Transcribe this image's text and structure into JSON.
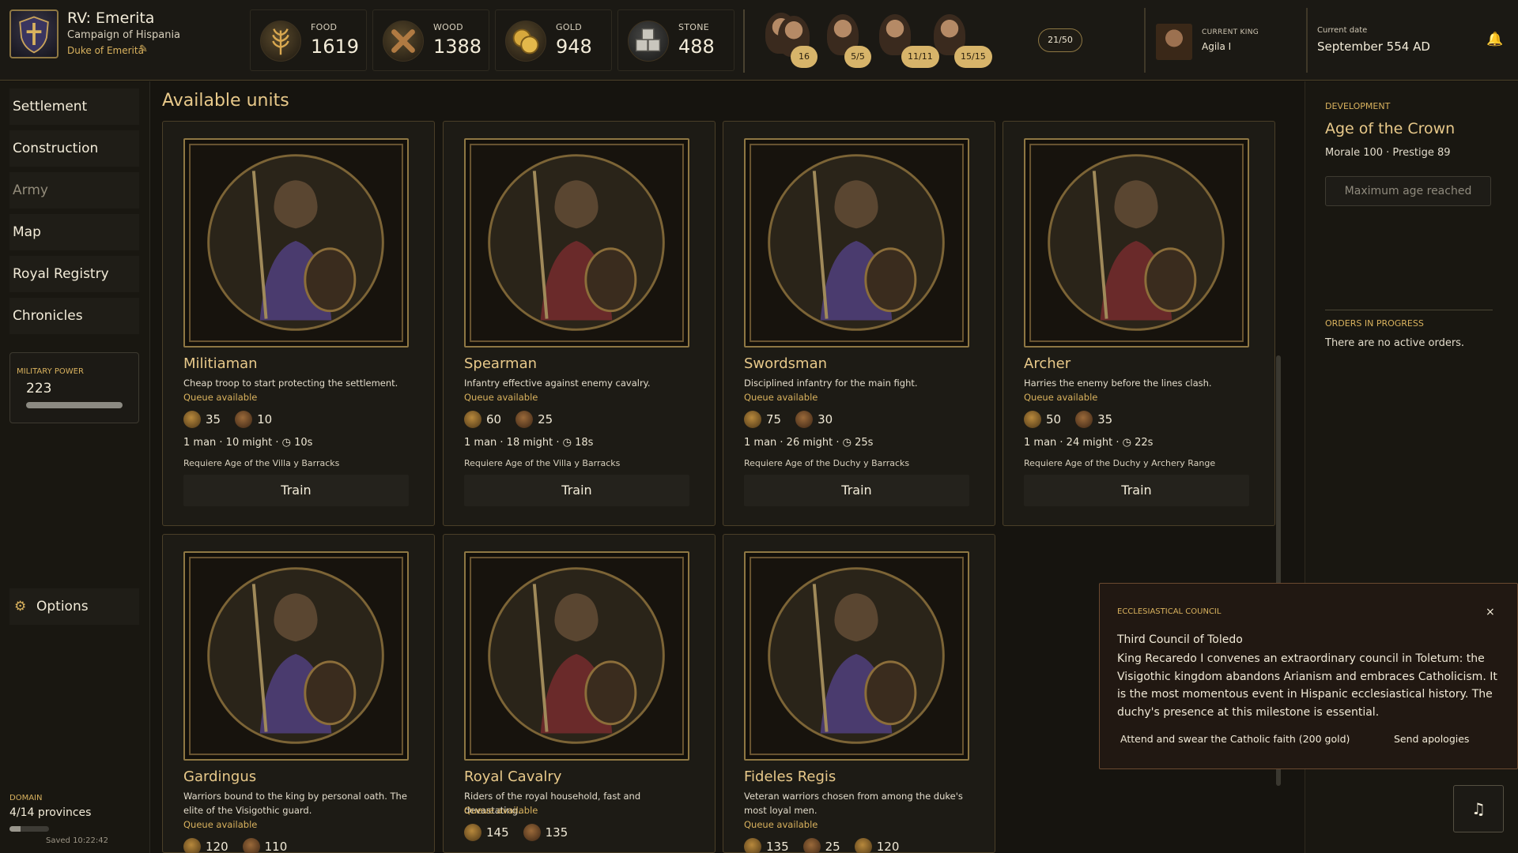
{
  "header": {
    "title": "RV: Emerita",
    "subtitle": "Campaign of Hispania",
    "rank": "Duke of Emerita",
    "resources": [
      {
        "label": "FOOD",
        "value": "1619",
        "icon": "wheat-icon"
      },
      {
        "label": "WOOD",
        "value": "1388",
        "icon": "logs-icon"
      },
      {
        "label": "GOLD",
        "value": "948",
        "icon": "coins-icon"
      },
      {
        "label": "STONE",
        "value": "488",
        "icon": "stone-blocks-icon"
      }
    ],
    "population": [
      {
        "count": "16"
      },
      {
        "count": "5/5"
      },
      {
        "count": "11/11"
      },
      {
        "count": "15/15"
      }
    ],
    "capacity": "21/50",
    "king_label": "CURRENT KING",
    "king_name": "Agila I",
    "date_label": "Current date",
    "date_value": "September 554 AD"
  },
  "sidebar": {
    "items": [
      {
        "label": "Settlement"
      },
      {
        "label": "Construction"
      },
      {
        "label": "Army"
      },
      {
        "label": "Map"
      },
      {
        "label": "Royal Registry"
      },
      {
        "label": "Chronicles"
      }
    ],
    "military_label": "MILITARY POWER",
    "military_value": "223",
    "military_fraction": 1.0,
    "options_label": "Options",
    "domain_label": "DOMAIN",
    "domain_value": "4/14 provinces",
    "domain_fraction": 0.2857,
    "saved": "Saved 10:22:42"
  },
  "main": {
    "title": "Available units",
    "units": [
      {
        "name": "Militiaman",
        "desc": "Cheap troop to start protecting the settlement.",
        "queue": "Queue available",
        "costs": [
          "35",
          "10"
        ],
        "stats": "1 man  ·  10 might  ·  ◷ 10s",
        "req": "Requiere Age of the Villa y Barracks",
        "train": "Train"
      },
      {
        "name": "Spearman",
        "desc": "Infantry effective against enemy cavalry.",
        "queue": "Queue available",
        "costs": [
          "60",
          "25"
        ],
        "stats": "1 man  ·  18 might  ·  ◷ 18s",
        "req": "Requiere Age of the Villa y Barracks",
        "train": "Train"
      },
      {
        "name": "Swordsman",
        "desc": "Disciplined infantry for the main fight.",
        "queue": "Queue available",
        "costs": [
          "75",
          "30"
        ],
        "stats": "1 man  ·  26 might  ·  ◷ 25s",
        "req": "Requiere Age of the Duchy y Barracks",
        "train": "Train"
      },
      {
        "name": "Archer",
        "desc": "Harries the enemy before the lines clash.",
        "queue": "Queue available",
        "costs": [
          "50",
          "35"
        ],
        "stats": "1 man  ·  24 might  ·  ◷ 22s",
        "req": "Requiere Age of the Duchy y Archery Range",
        "train": "Train"
      },
      {
        "name": "Gardingus",
        "desc": "Warriors bound to the king by personal oath. The elite of the Visigothic guard.",
        "queue": "Queue available",
        "costs": [
          "120",
          "110"
        ]
      },
      {
        "name": "Royal Cavalry",
        "desc": "Riders of the royal household, fast and devastating.",
        "queue": "Queue available",
        "costs": [
          "145",
          "135"
        ]
      },
      {
        "name": "Fideles Regis",
        "desc": "Veteran warriors chosen from among the duke's most loyal men.",
        "queue": "Queue available",
        "costs": [
          "135",
          "25",
          "120"
        ]
      }
    ]
  },
  "right": {
    "dev_label": "DEVELOPMENT",
    "dev_age": "Age of the Crown",
    "dev_stats": "Morale 100 · Prestige 89",
    "max_age": "Maximum age reached",
    "orders_label": "ORDERS IN PROGRESS",
    "orders_text": "There are no active orders."
  },
  "council": {
    "label": "ECCLESIASTICAL COUNCIL",
    "close": "×",
    "title": "Third Council of Toledo",
    "body": "King Recaredo I convenes an extraordinary council in Toletum: the Visigothic kingdom abandons Arianism and embraces Catholicism. It is the most momentous event in Hispanic ecclesiastical history. The duchy's presence at this milestone is essential.",
    "accept": "Attend and swear the Catholic faith (200 gold)",
    "decline": "Send apologies"
  },
  "music_icon": "♫",
  "bell_icon": "🔔",
  "options_icon": "⚙",
  "edit_icon": "✎"
}
